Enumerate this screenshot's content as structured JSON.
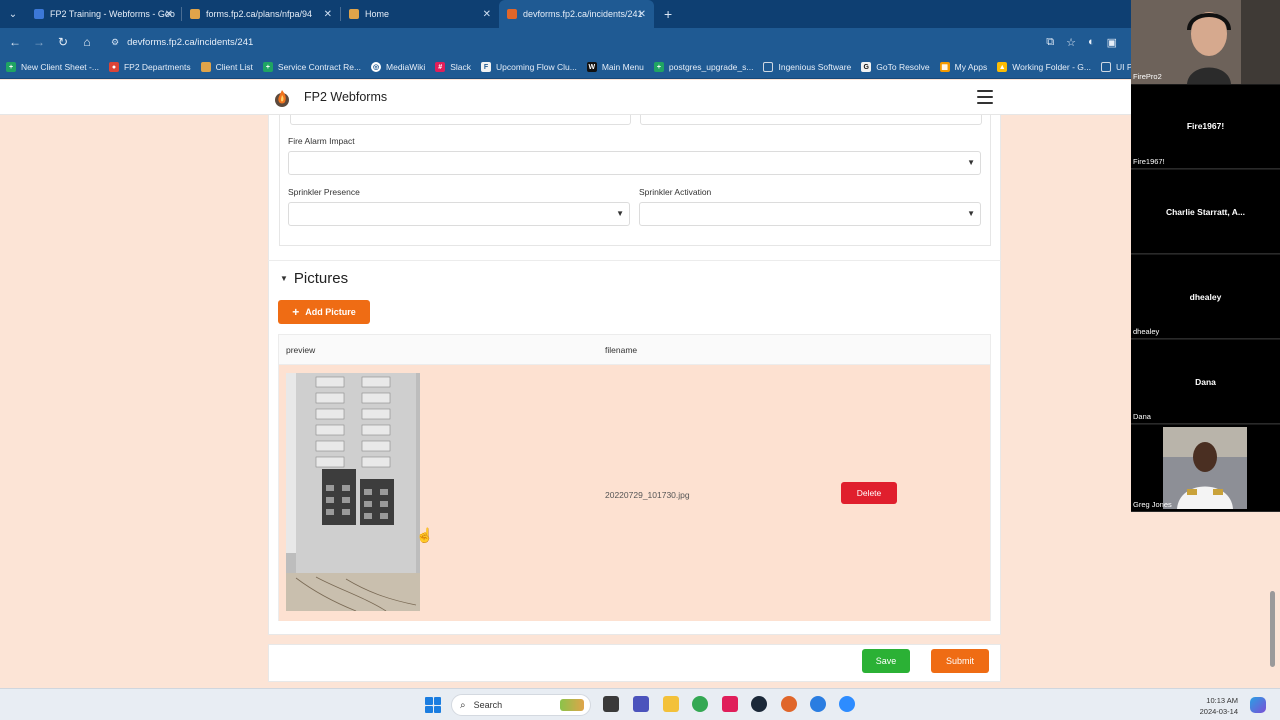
{
  "browser": {
    "tabs": [
      {
        "label": "FP2 Training - Webforms - Goo",
        "active": false,
        "fav_color": "#3c78d8"
      },
      {
        "label": "forms.fp2.ca/plans/nfpa/94",
        "active": false,
        "fav_color": "#e0a44a"
      },
      {
        "label": "Home",
        "active": false,
        "fav_color": "#e0a44a"
      },
      {
        "label": "devforms.fp2.ca/incidents/241",
        "active": true,
        "fav_color": "#e0662a"
      }
    ],
    "url": "devforms.fp2.ca/incidents/241",
    "bookmarks": [
      {
        "label": "New Client Sheet -...",
        "color": "#1fa463"
      },
      {
        "label": "FP2 Departments",
        "color": "#db4437"
      },
      {
        "label": "Client List",
        "color": "#e0a44a"
      },
      {
        "label": "Service Contract Re...",
        "color": "#1fa463"
      },
      {
        "label": "MediaWiki",
        "color": "#ffffff"
      },
      {
        "label": "Slack",
        "color": "#e01e5a"
      },
      {
        "label": "Upcoming Flow Clu...",
        "color": "#f2f2f2"
      },
      {
        "label": "Main Menu",
        "color": "#111111"
      },
      {
        "label": "postgres_upgrade_s...",
        "color": "#1fa463"
      },
      {
        "label": "Ingenious Software",
        "color": "#cfd8e3"
      },
      {
        "label": "GoTo Resolve",
        "color": "#f2f2f2"
      },
      {
        "label": "My Apps",
        "color": "#f29900"
      },
      {
        "label": "Working Folder - G...",
        "color": "#fbbc04"
      },
      {
        "label": "UI Project",
        "color": "#cfd8e3"
      }
    ]
  },
  "app": {
    "brand": "FP2 Webforms"
  },
  "form": {
    "fire_alarm_impact_label": "Fire Alarm Impact",
    "sprinkler_presence_label": "Sprinkler Presence",
    "sprinkler_activation_label": "Sprinkler Activation"
  },
  "pictures": {
    "title": "Pictures",
    "add_label": "Add Picture",
    "col_preview": "preview",
    "col_filename": "filename",
    "rows": [
      {
        "filename": "20220729_101730.jpg",
        "delete_label": "Delete"
      }
    ]
  },
  "actions": {
    "save_label": "Save",
    "submit_label": "Submit"
  },
  "video": {
    "tiles": [
      {
        "center": "",
        "tag": "FirePro2",
        "has_video": true
      },
      {
        "center": "Fire1967!",
        "tag": "Fire1967!",
        "has_video": false
      },
      {
        "center": "Charlie Starratt, A...",
        "tag": "",
        "has_video": false
      },
      {
        "center": "dhealey",
        "tag": "dhealey",
        "has_video": false
      },
      {
        "center": "Dana",
        "tag": "Dana",
        "has_video": false
      },
      {
        "center": "",
        "tag": "Greg Jones",
        "has_video": true
      }
    ]
  },
  "taskbar": {
    "search_placeholder": "Search",
    "time": "10:13 AM",
    "date": "2024-03-14"
  }
}
